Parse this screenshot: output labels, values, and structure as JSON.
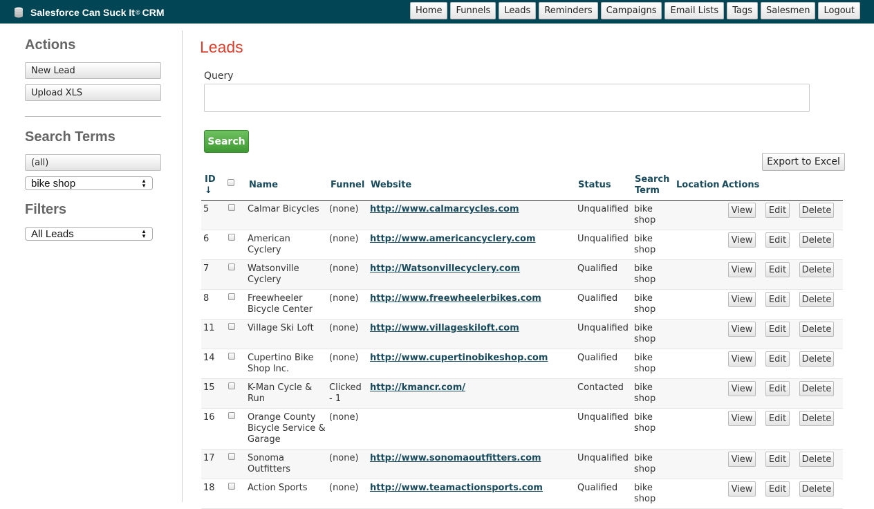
{
  "app": {
    "title": "Salesforce Can Suck It",
    "title_sup": "©",
    "title_suffix": "CRM"
  },
  "nav": [
    "Home",
    "Funnels",
    "Leads",
    "Reminders",
    "Campaigns",
    "Email Lists",
    "Tags",
    "Salesmen",
    "Logout"
  ],
  "sidebar": {
    "actions_heading": "Actions",
    "new_lead": "New Lead",
    "upload_xls": "Upload XLS",
    "search_terms_heading": "Search Terms",
    "all_terms": "(all)",
    "search_term_selected": "bike shop",
    "filters_heading": "Filters",
    "filter_selected": "All Leads"
  },
  "main": {
    "title": "Leads",
    "query_label": "Query",
    "query_value": "",
    "search_button": "Search",
    "export_button": "Export to Excel"
  },
  "table": {
    "headers": {
      "id": "ID",
      "sort_arrow": "↓",
      "name": "Name",
      "funnel": "Funnel",
      "website": "Website",
      "status": "Status",
      "search_term": [
        "Search",
        "Term"
      ],
      "location": "Location",
      "actions": "Actions"
    },
    "row_buttons": {
      "view": "View",
      "edit": "Edit",
      "delete": "Delete"
    },
    "rows": [
      {
        "id": "5",
        "name": [
          "Calmar Bicycles"
        ],
        "funnel": [
          "(none)"
        ],
        "website": "http://www.calmarcycles.com",
        "status": "Unqualified",
        "term": [
          "bike",
          "shop"
        ],
        "location": ""
      },
      {
        "id": "6",
        "name": [
          "American",
          "Cyclery"
        ],
        "funnel": [
          "(none)"
        ],
        "website": "http://www.americancyclery.com",
        "status": "Unqualified",
        "term": [
          "bike",
          "shop"
        ],
        "location": ""
      },
      {
        "id": "7",
        "name": [
          "Watsonville",
          "Cyclery"
        ],
        "funnel": [
          "(none)"
        ],
        "website": "http://Watsonvillecyclery.com",
        "status": "Qualified",
        "term": [
          "bike",
          "shop"
        ],
        "location": ""
      },
      {
        "id": "8",
        "name": [
          "Freewheeler",
          "Bicycle Center"
        ],
        "funnel": [
          "(none)"
        ],
        "website": "http://www.freewheelerbikes.com",
        "status": "Qualified",
        "term": [
          "bike",
          "shop"
        ],
        "location": ""
      },
      {
        "id": "11",
        "name": [
          "Village Ski Loft"
        ],
        "funnel": [
          "(none)"
        ],
        "website": "http://www.villageskiloft.com",
        "status": "Unqualified",
        "term": [
          "bike",
          "shop"
        ],
        "location": ""
      },
      {
        "id": "14",
        "name": [
          "Cupertino Bike",
          "Shop Inc."
        ],
        "funnel": [
          "(none)"
        ],
        "website": "http://www.cupertinobikeshop.com",
        "status": "Qualified",
        "term": [
          "bike",
          "shop"
        ],
        "location": ""
      },
      {
        "id": "15",
        "name": [
          "K-Man Cycle &",
          "Run"
        ],
        "funnel": [
          "Clicked",
          "- 1"
        ],
        "website": "http://kmancr.com/",
        "status": "Contacted",
        "term": [
          "bike",
          "shop"
        ],
        "location": ""
      },
      {
        "id": "16",
        "name": [
          "Orange County",
          "Bicycle Service &",
          "Garage"
        ],
        "funnel": [
          "(none)"
        ],
        "website": "",
        "status": "Unqualified",
        "term": [
          "bike",
          "shop"
        ],
        "location": ""
      },
      {
        "id": "17",
        "name": [
          "Sonoma",
          "Outfitters"
        ],
        "funnel": [
          "(none)"
        ],
        "website": "http://www.sonomaoutfitters.com",
        "status": "Unqualified",
        "term": [
          "bike",
          "shop"
        ],
        "location": ""
      },
      {
        "id": "18",
        "name": [
          "Action Sports"
        ],
        "funnel": [
          "(none)"
        ],
        "website": "http://www.teamactionsports.com",
        "status": "Qualified",
        "term": [
          "bike",
          "shop"
        ],
        "location": ""
      }
    ]
  }
}
